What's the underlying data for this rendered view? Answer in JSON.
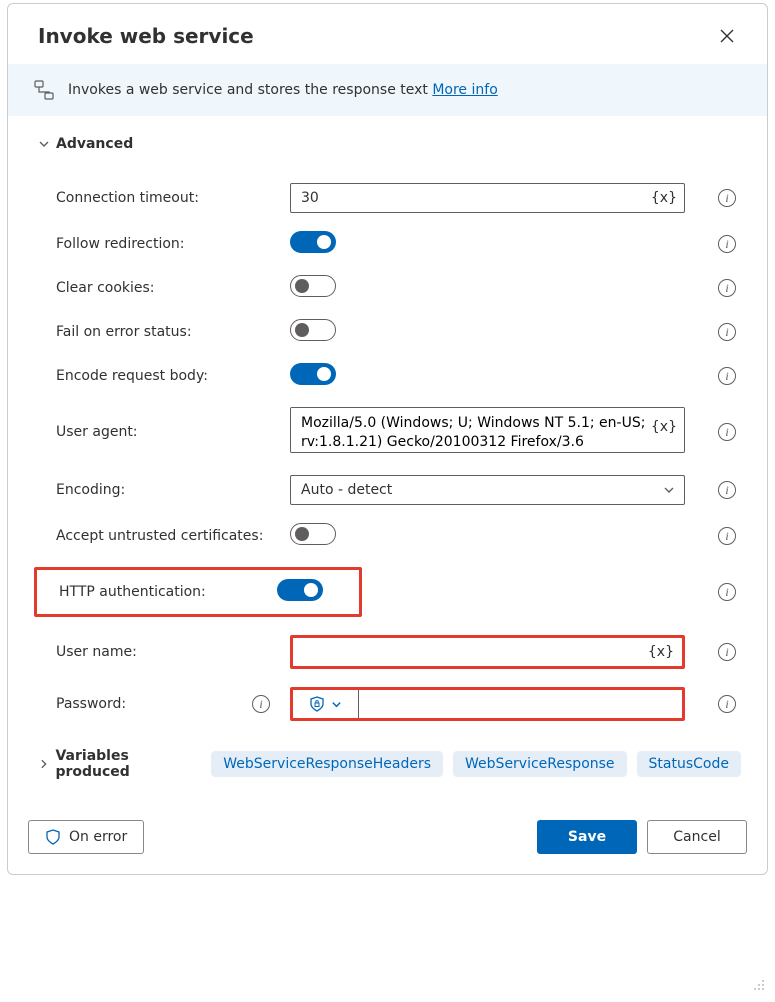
{
  "header": {
    "title": "Invoke web service"
  },
  "banner": {
    "text": "Invokes a web service and stores the response text ",
    "more": "More info"
  },
  "section": {
    "advanced": "Advanced"
  },
  "fields": {
    "conn_timeout": {
      "label": "Connection timeout:",
      "value": "30"
    },
    "follow_redirect": {
      "label": "Follow redirection:",
      "on": true
    },
    "clear_cookies": {
      "label": "Clear cookies:",
      "on": false
    },
    "fail_on_error": {
      "label": "Fail on error status:",
      "on": false
    },
    "encode_body": {
      "label": "Encode request body:",
      "on": true
    },
    "user_agent": {
      "label": "User agent:",
      "value": "Mozilla/5.0 (Windows; U; Windows NT 5.1; en-US; rv:1.8.1.21) Gecko/20100312 Firefox/3.6"
    },
    "encoding": {
      "label": "Encoding:",
      "value": "Auto - detect"
    },
    "accept_untrusted": {
      "label": "Accept untrusted certificates:",
      "on": false
    },
    "http_auth": {
      "label": "HTTP authentication:",
      "on": true
    },
    "username": {
      "label": "User name:",
      "value": ""
    },
    "password": {
      "label": "Password:",
      "value": ""
    }
  },
  "var_token": "{x}",
  "variables": {
    "label": "Variables produced",
    "items": [
      "WebServiceResponseHeaders",
      "WebServiceResponse",
      "StatusCode"
    ]
  },
  "footer": {
    "on_error": "On error",
    "save": "Save",
    "cancel": "Cancel"
  }
}
